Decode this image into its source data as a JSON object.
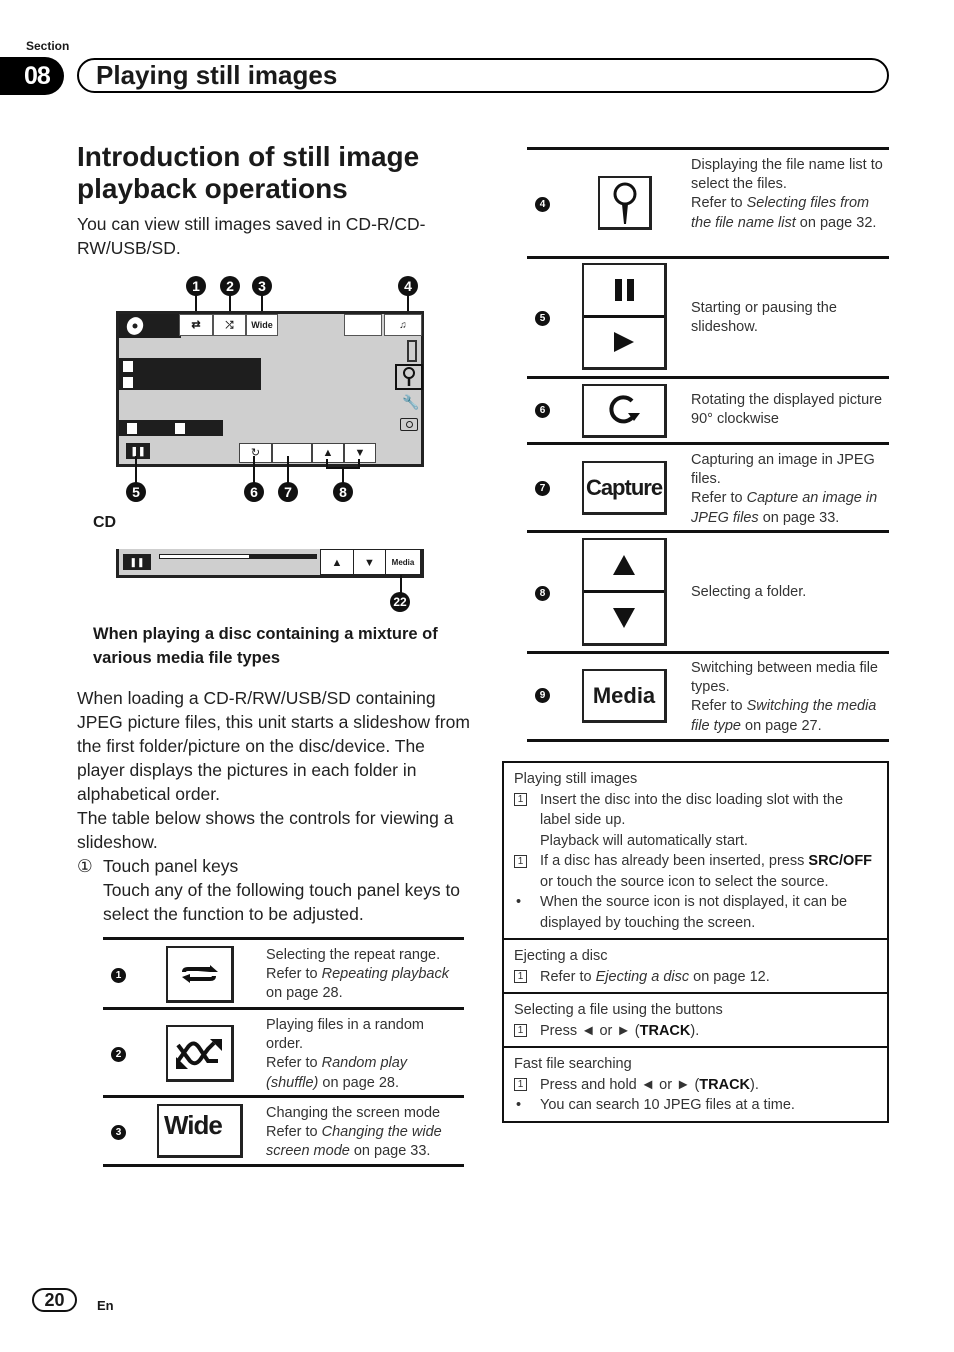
{
  "header": {
    "section_label": "Section",
    "section_number": "08",
    "section_title": "Playing still images"
  },
  "heading": "Introduction of still image playback operations",
  "intro": "You can view still images saved in CD-R/CD-RW/USB/SD.",
  "diagram": {
    "callouts": [
      "1",
      "2",
      "3",
      "4",
      "5",
      "6",
      "7",
      "8"
    ],
    "wide_label": "Wide",
    "cd_label": "CD",
    "media_label": "Media",
    "media_callout": "22",
    "progress_fraction": 0.57
  },
  "sub_heading": "When playing a disc containing a mixture of various media file types",
  "body": {
    "paragraph1": "When loading a CD-R/RW/USB/SD containing JPEG picture files, this unit starts a slideshow from the first folder/picture on the disc/device. The player displays the pictures in each folder in alphabetical order.",
    "paragraph2": "The table below shows the controls for viewing a slideshow.",
    "item_marker": "①",
    "item_title": "Touch panel keys",
    "item_text": "Touch any of the following touch panel keys to select the function to be adjusted."
  },
  "keys": [
    {
      "num": "1",
      "icon": "repeat-icon",
      "desc_plain": "Selecting the repeat range.",
      "refer": "Refer to ",
      "ref_title": "Repeating playback",
      "ref_page": " on page 28."
    },
    {
      "num": "2",
      "icon": "shuffle-icon",
      "desc_plain": "Playing files in a random order.",
      "refer": "Refer to ",
      "ref_title": "Random play (shuffle)",
      "ref_page": " on page 28."
    },
    {
      "num": "3",
      "icon": "wide-icon",
      "icon_label": "Wide",
      "desc_plain": "Changing the screen mode",
      "refer": "Refer to ",
      "ref_title": "Changing the wide screen mode",
      "ref_page": " on page 33."
    },
    {
      "num": "4",
      "icon": "search-icon",
      "desc_plain": "Displaying the file name list to select the files.",
      "refer": "Refer to ",
      "ref_title": "Selecting files from the file name list",
      "ref_page": " on page 32."
    },
    {
      "num": "5",
      "icon": "pause-play-icon",
      "desc_plain": "Starting or pausing the slideshow."
    },
    {
      "num": "6",
      "icon": "rotate-icon",
      "desc_plain": "Rotating the displayed picture 90° clockwise"
    },
    {
      "num": "7",
      "icon": "capture-icon",
      "icon_label": "Capture",
      "desc_plain": "Capturing an image in JPEG files.",
      "refer": "Refer to ",
      "ref_title": "Capture an image in JPEG files",
      "ref_page": " on page 33."
    },
    {
      "num": "8",
      "icon": "folder-up-down-icon",
      "desc_plain": "Selecting a folder."
    },
    {
      "num": "9",
      "icon": "media-icon",
      "icon_label": "Media",
      "desc_plain": "Switching between media file types.",
      "refer": "Refer to ",
      "ref_title": "Switching the media file type",
      "ref_page": " on page 27."
    }
  ],
  "procedures": [
    {
      "title": "Playing still images",
      "step1": "Insert the disc into the disc loading slot with the label side up.",
      "step1_note": "Playback will automatically start.",
      "step2_pre": "If a disc has already been inserted, press ",
      "step2_bold": "SRC/OFF",
      "step2_post": " or touch the source icon to select the source.",
      "bullet": "When the source icon is not displayed, it can be displayed by touching the screen."
    },
    {
      "title": "Ejecting a disc",
      "step_pre": "Refer to ",
      "step_italic": "Ejecting a disc",
      "step_post": " on page 12."
    },
    {
      "title": "Selecting a file using the buttons",
      "step_pre": "Press ◄ or ► (",
      "step_bold": "TRACK",
      "step_post": ")."
    },
    {
      "title": "Fast file searching",
      "step_pre": "Press and hold ◄ or ► (",
      "step_bold": "TRACK",
      "step_post": ").",
      "bullet": "You can search 10 JPEG files at a time."
    }
  ],
  "step_marker": "1",
  "bullet_marker": "•",
  "footer": {
    "page_number": "20",
    "language": "En"
  }
}
